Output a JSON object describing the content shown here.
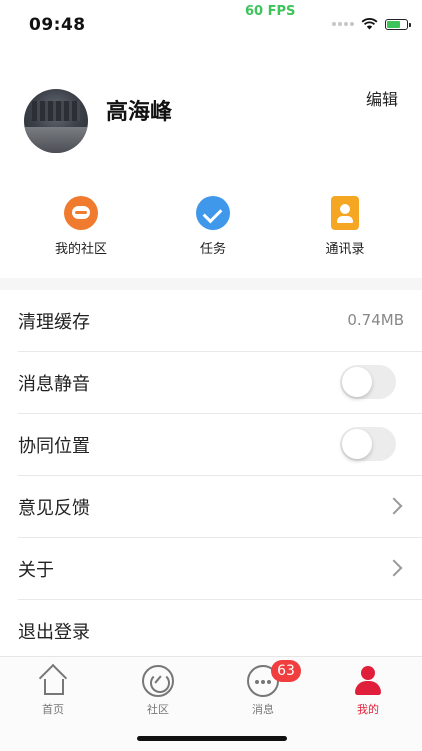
{
  "status_bar": {
    "time": "09:48",
    "fps": "60 FPS"
  },
  "profile": {
    "name": "高海峰",
    "edit_label": "编辑"
  },
  "quick_actions": [
    {
      "label": "我的社区",
      "icon": "community-chat-icon"
    },
    {
      "label": "任务",
      "icon": "task-check-icon"
    },
    {
      "label": "通讯录",
      "icon": "contacts-icon"
    }
  ],
  "settings": {
    "clear_cache": {
      "label": "清理缓存",
      "value": "0.74MB"
    },
    "mute": {
      "label": "消息静音"
    },
    "location": {
      "label": "协同位置"
    },
    "feedback": {
      "label": "意见反馈"
    },
    "about": {
      "label": "关于"
    },
    "logout": {
      "label": "退出登录"
    }
  },
  "tabs": [
    {
      "label": "首页",
      "icon": "home-icon"
    },
    {
      "label": "社区",
      "icon": "community-icon"
    },
    {
      "label": "消息",
      "icon": "message-icon",
      "badge": "63"
    },
    {
      "label": "我的",
      "icon": "person-icon",
      "active": true
    }
  ],
  "colors": {
    "accent": "#e0203a",
    "fps": "#3cc35a",
    "badge": "#f03e3e"
  }
}
